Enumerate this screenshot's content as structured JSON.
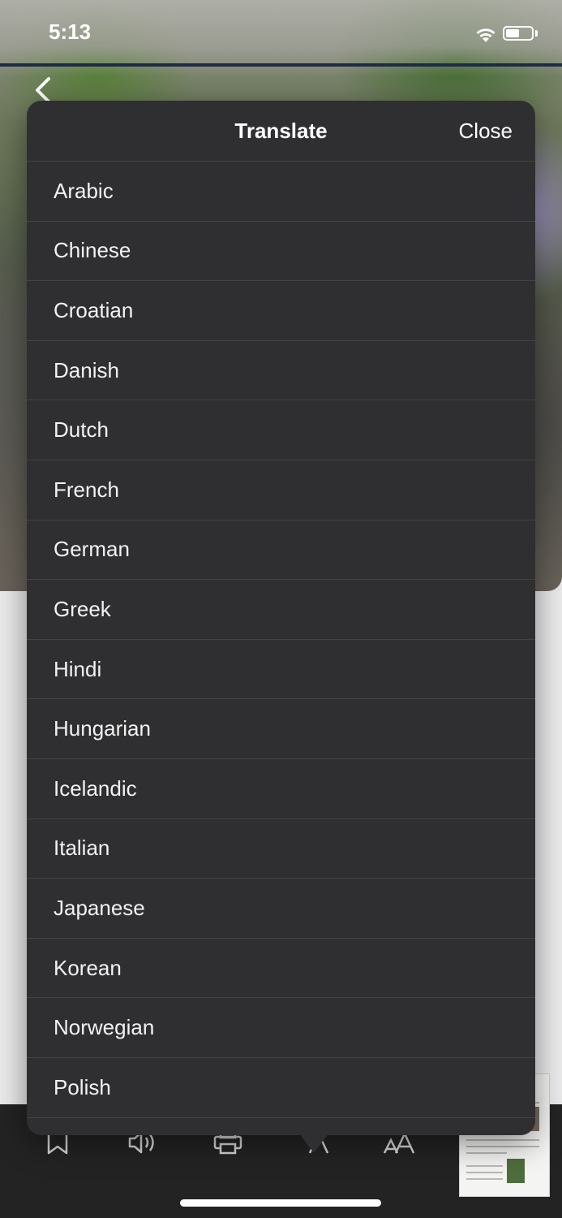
{
  "status_bar": {
    "time": "5:13"
  },
  "popover": {
    "title": "Translate",
    "close_label": "Close",
    "languages": [
      "Arabic",
      "Chinese",
      "Croatian",
      "Danish",
      "Dutch",
      "French",
      "German",
      "Greek",
      "Hindi",
      "Hungarian",
      "Icelandic",
      "Italian",
      "Japanese",
      "Korean",
      "Norwegian",
      "Polish"
    ]
  },
  "toolbar": {
    "icons": [
      "bookmark-icon",
      "speaker-icon",
      "print-icon",
      "translate-icon",
      "text-size-icon"
    ]
  },
  "colors": {
    "popover_bg": "#2f2f31",
    "separator": "#434345",
    "toolbar_bg": "#232323",
    "text": "#f2f2f2"
  }
}
